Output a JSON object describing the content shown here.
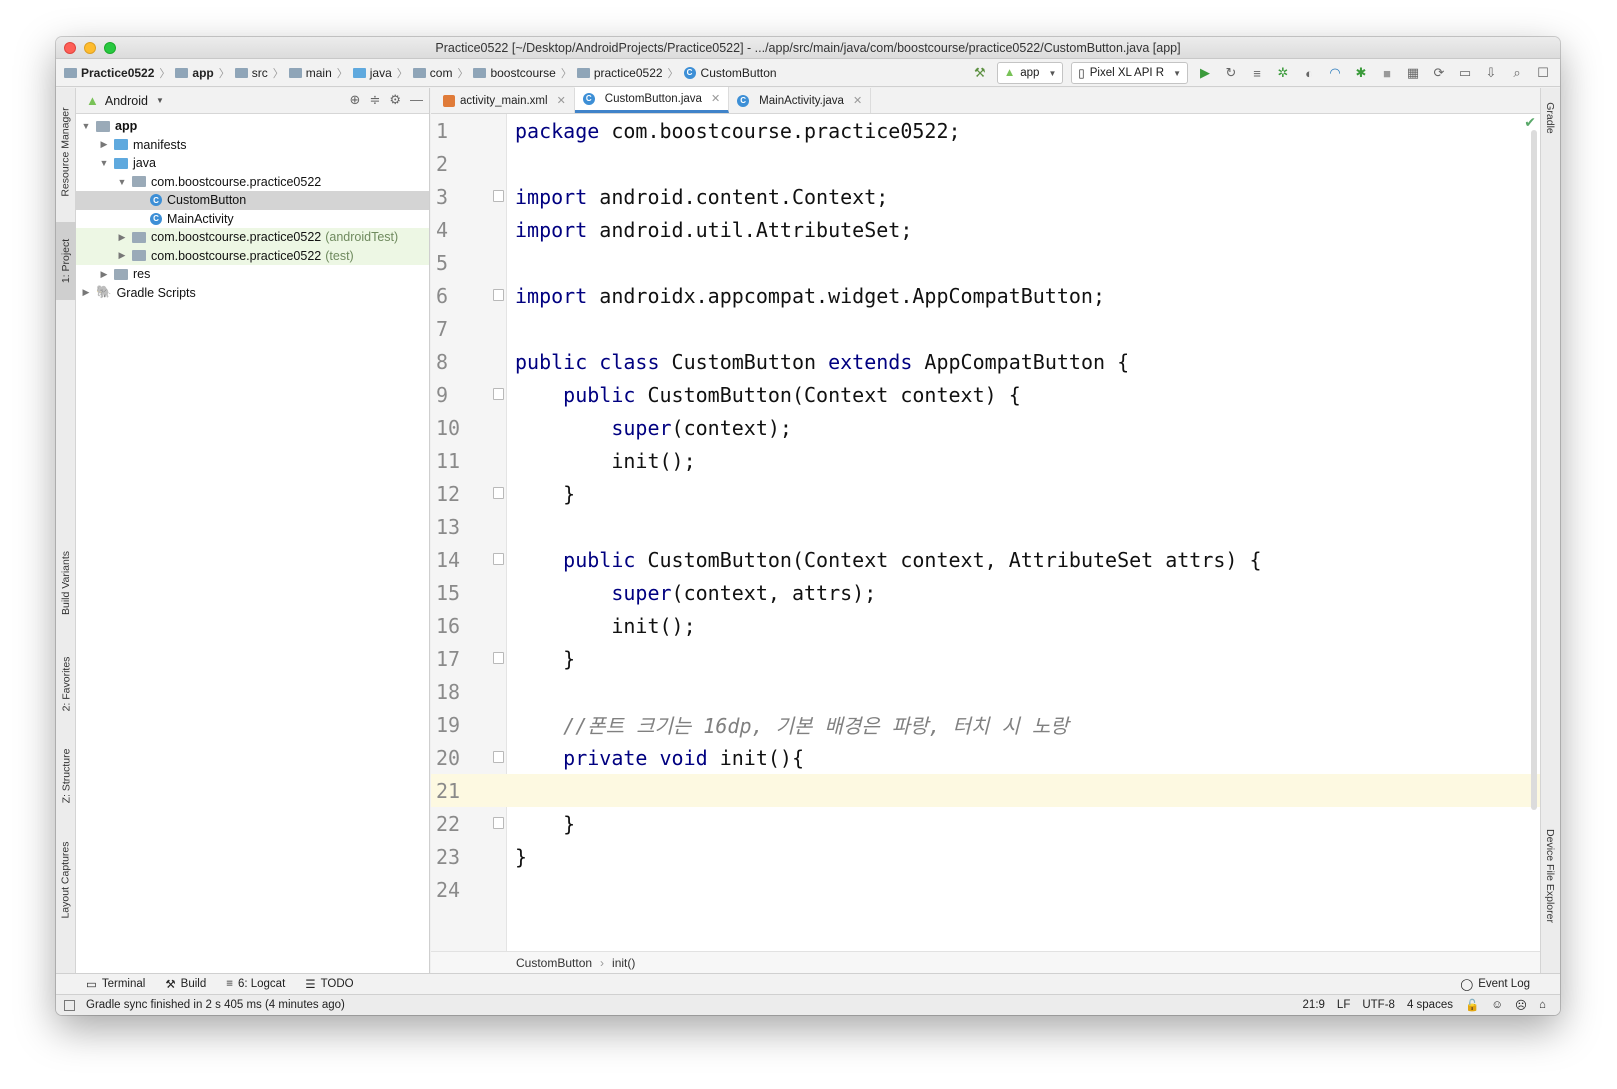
{
  "window": {
    "title": "Practice0522 [~/Desktop/AndroidProjects/Practice0522] - .../app/src/main/java/com/boostcourse/practice0522/CustomButton.java [app]"
  },
  "nav": {
    "crumbs": [
      "Practice0522",
      "app",
      "src",
      "main",
      "java",
      "com",
      "boostcourse",
      "practice0522",
      "CustomButton"
    ],
    "run_config": "app",
    "device": "Pixel XL API R"
  },
  "left_tool_windows": [
    "Resource Manager",
    "1: Project",
    "Build Variants",
    "2: Favorites",
    "Z: Structure",
    "Layout Captures"
  ],
  "right_tool_windows": [
    "Gradle",
    "Device File Explorer"
  ],
  "project": {
    "view_mode": "Android",
    "tree": [
      {
        "label": "app",
        "suffix": ""
      },
      {
        "label": "manifests",
        "suffix": ""
      },
      {
        "label": "java",
        "suffix": ""
      },
      {
        "label": "com.boostcourse.practice0522",
        "suffix": ""
      },
      {
        "label": "CustomButton",
        "suffix": ""
      },
      {
        "label": "MainActivity",
        "suffix": ""
      },
      {
        "label": "com.boostcourse.practice0522",
        "suffix": "(androidTest)"
      },
      {
        "label": "com.boostcourse.practice0522",
        "suffix": "(test)"
      },
      {
        "label": "res",
        "suffix": ""
      },
      {
        "label": "Gradle Scripts",
        "suffix": ""
      }
    ]
  },
  "editor": {
    "tabs": [
      "activity_main.xml",
      "CustomButton.java",
      "MainActivity.java"
    ],
    "active_tab": "CustomButton.java",
    "lines": [
      {
        "n": "1",
        "code": "package com.boostcourse.practice0522;"
      },
      {
        "n": "2",
        "code": ""
      },
      {
        "n": "3",
        "code": "import android.content.Context;"
      },
      {
        "n": "4",
        "code": "import android.util.AttributeSet;"
      },
      {
        "n": "5",
        "code": ""
      },
      {
        "n": "6",
        "code": "import androidx.appcompat.widget.AppCompatButton;"
      },
      {
        "n": "7",
        "code": ""
      },
      {
        "n": "8",
        "code": "public class CustomButton extends AppCompatButton {"
      },
      {
        "n": "9",
        "code": "    public CustomButton(Context context) {"
      },
      {
        "n": "10",
        "code": "        super(context);"
      },
      {
        "n": "11",
        "code": "        init();"
      },
      {
        "n": "12",
        "code": "    }"
      },
      {
        "n": "13",
        "code": ""
      },
      {
        "n": "14",
        "code": "    public CustomButton(Context context, AttributeSet attrs) {"
      },
      {
        "n": "15",
        "code": "        super(context, attrs);"
      },
      {
        "n": "16",
        "code": "        init();"
      },
      {
        "n": "17",
        "code": "    }"
      },
      {
        "n": "18",
        "code": ""
      },
      {
        "n": "19",
        "code": "    //폰트 크기는 16dp, 기본 배경은 파랑, 터치 시 노랑"
      },
      {
        "n": "20",
        "code": "    private void init(){"
      },
      {
        "n": "21",
        "code": ""
      },
      {
        "n": "22",
        "code": "    }"
      },
      {
        "n": "23",
        "code": "}"
      },
      {
        "n": "24",
        "code": ""
      }
    ],
    "current_line": "21",
    "breadcrumb": [
      "CustomButton",
      "init()"
    ]
  },
  "bottom_tools": [
    "Terminal",
    "Build",
    "6: Logcat",
    "TODO"
  ],
  "event_log": "Event Log",
  "status": {
    "message": "Gradle sync finished in 2 s 405 ms (4 minutes ago)",
    "position": "21:9",
    "line_sep": "LF",
    "encoding": "UTF-8",
    "indent": "4 spaces"
  },
  "colors": {
    "keyword": "#000080",
    "comment": "#808080",
    "accent": "#4083c9",
    "current_line": "#fdf9e1"
  }
}
